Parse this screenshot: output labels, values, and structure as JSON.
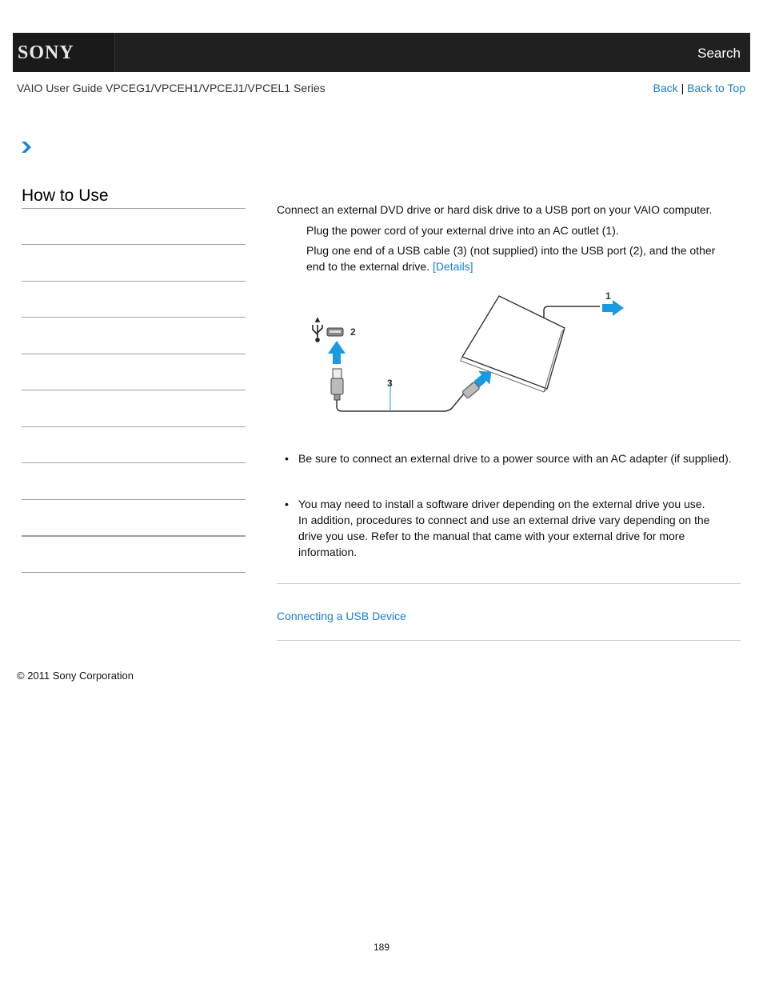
{
  "header": {
    "brand": "SONY",
    "search_label": "Search"
  },
  "subheader": {
    "guide_title": "VAIO User Guide VPCEG1/VPCEH1/VPCEJ1/VPCEL1 Series",
    "back_label": "Back",
    "separator": "|",
    "back_to_top_label": "Back to Top"
  },
  "sidebar": {
    "title": "How to Use",
    "items": [
      "",
      "",
      "",
      "",
      "",
      "",
      "",
      "",
      "",
      ""
    ]
  },
  "main": {
    "intro": "Connect an external DVD drive or hard disk drive to a USB port on your VAIO computer.",
    "steps": [
      {
        "text": "Plug the power cord of your external drive into an AC outlet (1)."
      },
      {
        "text": "Plug one end of a USB cable (3) (not supplied) into the USB port (2), and the other end to the external drive.",
        "link_label": "[Details]"
      }
    ],
    "diagram": {
      "callouts": [
        "1",
        "2",
        "3"
      ],
      "arrow_color": "#1a9be0",
      "icons": [
        "usb-symbol-icon",
        "usb-port-icon",
        "external-drive",
        "usb-plug-icon"
      ]
    },
    "notes": [
      {
        "text": "Be sure to connect an external drive to a power source with an AC adapter (if supplied)."
      },
      {
        "lines": [
          "You may need to install a software driver depending on the external drive you use.",
          "In addition, procedures to connect and use an external drive vary depending on the drive you use. Refer to the manual that came with your external drive for more information."
        ]
      }
    ],
    "related_link": "Connecting a USB Device"
  },
  "footer": {
    "copyright": "© 2011 Sony Corporation",
    "page_number": "189"
  },
  "colors": {
    "link": "#1a7ed0",
    "topbar": "#202020",
    "chevron": "#1a86d0"
  }
}
